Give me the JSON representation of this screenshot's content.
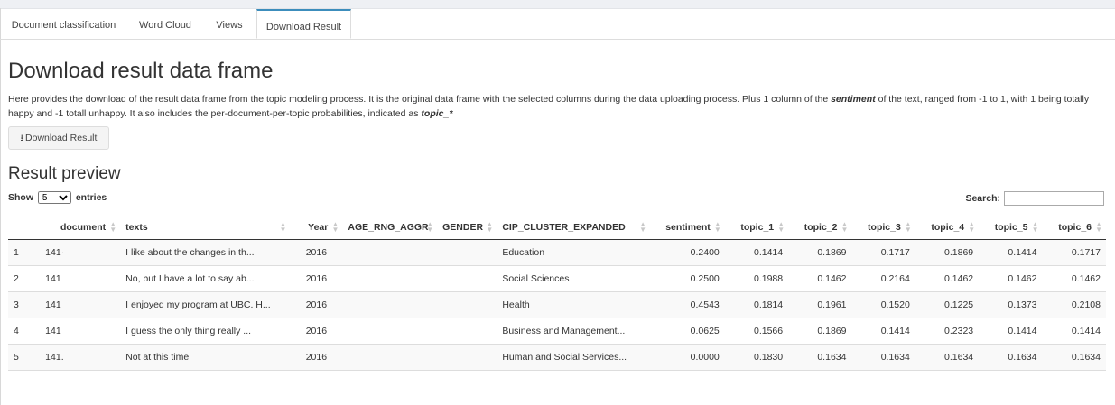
{
  "tabs": [
    {
      "label": "Document classification"
    },
    {
      "label": "Word Cloud"
    },
    {
      "label": "Views"
    },
    {
      "label": "Download Result"
    }
  ],
  "main": {
    "title": "Download result data frame",
    "desc_part1": "Here provides the download of the result data frame from the topic modeling process. It is the original data frame with the selected columns during the data uploading process. Plus 1 column of the ",
    "desc_em1": "sentiment",
    "desc_part2": " of the text, ranged from -1 to 1, with 1 being totally happy and -1 totall unhappy. It also includes the per-document-per-topic probabilities, indicated as ",
    "desc_em2": "topic_*",
    "download_label": "Download Result",
    "preview_title": "Result preview",
    "show_label": "Show",
    "entries_value": "5",
    "entries_label": "entries",
    "search_label": "Search:"
  },
  "table": {
    "headers": [
      "document",
      "texts",
      "Year",
      "AGE_RNG_AGGR",
      "GENDER",
      "CIP_CLUSTER_EXPANDED",
      "sentiment",
      "topic_1",
      "topic_2",
      "topic_3",
      "topic_4",
      "topic_5",
      "topic_6"
    ],
    "rows": [
      {
        "n": "1",
        "doc": "141·",
        "text": "I like about the changes in th...",
        "year": "2016",
        "cip": "Education",
        "sent": "0.2400",
        "t1": "0.1414",
        "t2": "0.1869",
        "t3": "0.1717",
        "t4": "0.1869",
        "t5": "0.1414",
        "t6": "0.1717"
      },
      {
        "n": "2",
        "doc": "141",
        "text": "No, but I have a lot to say ab...",
        "year": "2016",
        "cip": "Social Sciences",
        "sent": "0.2500",
        "t1": "0.1988",
        "t2": "0.1462",
        "t3": "0.2164",
        "t4": "0.1462",
        "t5": "0.1462",
        "t6": "0.1462"
      },
      {
        "n": "3",
        "doc": "141",
        "text": "I enjoyed my program at UBC. H...",
        "year": "2016",
        "cip": "Health",
        "sent": "0.4543",
        "t1": "0.1814",
        "t2": "0.1961",
        "t3": "0.1520",
        "t4": "0.1225",
        "t5": "0.1373",
        "t6": "0.2108"
      },
      {
        "n": "4",
        "doc": "141",
        "text": "I guess the only thing really ...",
        "year": "2016",
        "cip": "Business and Management...",
        "sent": "0.0625",
        "t1": "0.1566",
        "t2": "0.1869",
        "t3": "0.1414",
        "t4": "0.2323",
        "t5": "0.1414",
        "t6": "0.1414"
      },
      {
        "n": "5",
        "doc": "141.",
        "text": "Not at this time",
        "year": "2016",
        "cip": "Human and Social Services...",
        "sent": "0.0000",
        "t1": "0.1830",
        "t2": "0.1634",
        "t3": "0.1634",
        "t4": "0.1634",
        "t5": "0.1634",
        "t6": "0.1634"
      }
    ]
  }
}
